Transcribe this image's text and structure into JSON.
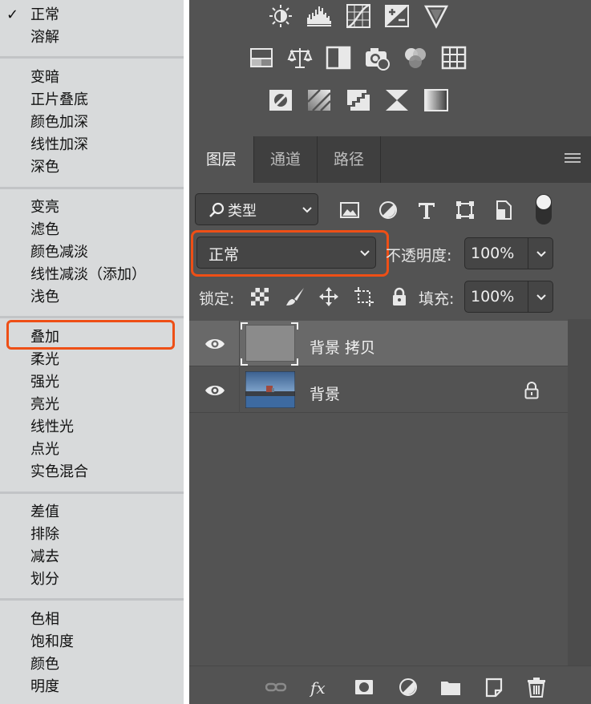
{
  "blend_menu": {
    "selected_check": "✓",
    "groups": [
      [
        "正常",
        "溶解"
      ],
      [
        "变暗",
        "正片叠底",
        "颜色加深",
        "线性加深",
        "深色"
      ],
      [
        "变亮",
        "滤色",
        "颜色减淡",
        "线性减淡（添加）",
        "浅色"
      ],
      [
        "叠加",
        "柔光",
        "强光",
        "亮光",
        "线性光",
        "点光",
        "实色混合"
      ],
      [
        "差值",
        "排除",
        "减去",
        "划分"
      ],
      [
        "色相",
        "饱和度",
        "颜色",
        "明度"
      ]
    ],
    "highlighted_item": "叠加"
  },
  "adjustments": {
    "row1": [
      "brightness-contrast-icon",
      "levels-icon",
      "curves-icon",
      "exposure-icon"
    ],
    "row2": [
      "vibrance-icon",
      "hue-saturation-icon",
      "color-balance-icon",
      "black-white-icon",
      "photo-filter-icon",
      "channel-mixer-icon",
      "color-lookup-icon"
    ],
    "row3": [
      "invert-icon",
      "posterize-icon",
      "threshold-icon",
      "selective-color-icon",
      "gradient-map-icon"
    ]
  },
  "tabs": [
    "图层",
    "通道",
    "路径"
  ],
  "active_tab": "图层",
  "filter": {
    "kind_label": "类型",
    "icons": [
      "image-filter-icon",
      "adjustment-filter-icon",
      "type-filter-icon",
      "shape-filter-icon",
      "smart-object-filter-icon"
    ]
  },
  "blend": {
    "mode": "正常",
    "opacity_label": "不透明度:",
    "opacity_value": "100%"
  },
  "lock": {
    "label": "锁定:",
    "fill_label": "填充:",
    "fill_value": "100%"
  },
  "layers": [
    {
      "name": "背景 拷贝",
      "visible": true,
      "selected": true,
      "locked": false
    },
    {
      "name": "背景",
      "visible": true,
      "selected": false,
      "locked": true
    }
  ],
  "colors": {
    "highlight": "#ee4f16",
    "panel": "#535353",
    "menu": "#d8dadb"
  }
}
